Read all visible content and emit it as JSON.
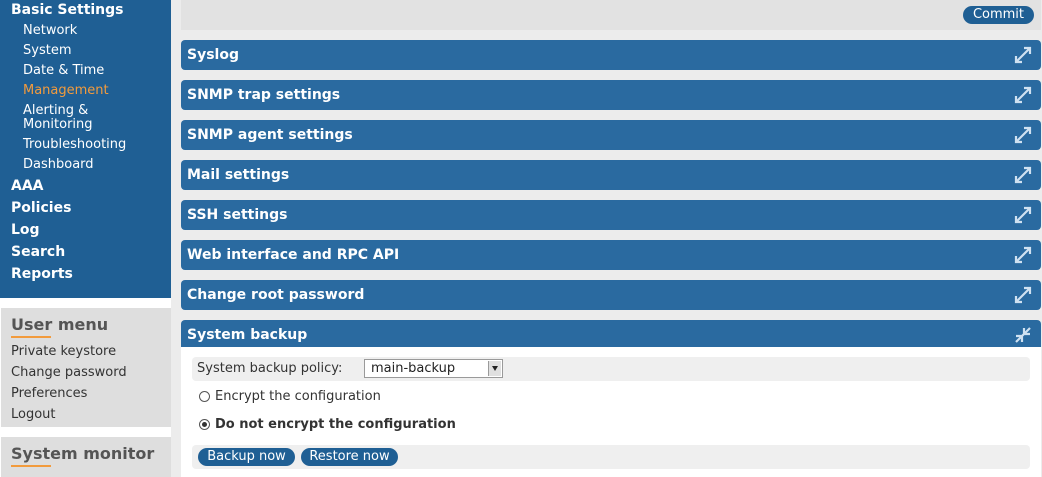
{
  "sidebar": {
    "nav": {
      "basic_settings": "Basic Settings",
      "sub": [
        "Network",
        "System",
        "Date & Time",
        "Management",
        "Alerting &",
        "Monitoring",
        "Troubleshooting",
        "Dashboard"
      ],
      "active_item": "Management",
      "aaa": "AAA",
      "policies": "Policies",
      "log": "Log",
      "search": "Search",
      "reports": "Reports"
    },
    "user_menu": {
      "title": "User menu",
      "links": [
        "Private keystore",
        "Change password",
        "Preferences",
        "Logout"
      ]
    },
    "system_monitor": {
      "title": "System monitor"
    }
  },
  "toolbar": {
    "commit_label": "Commit"
  },
  "panels": [
    {
      "title": "Syslog",
      "state": "collapsed"
    },
    {
      "title": "SNMP trap settings",
      "state": "collapsed"
    },
    {
      "title": "SNMP agent settings",
      "state": "collapsed"
    },
    {
      "title": "Mail settings",
      "state": "collapsed"
    },
    {
      "title": "SSH settings",
      "state": "collapsed"
    },
    {
      "title": "Web interface and RPC API",
      "state": "collapsed"
    },
    {
      "title": "Change root password",
      "state": "collapsed"
    },
    {
      "title": "System backup",
      "state": "expanded"
    }
  ],
  "backup": {
    "policy_label": "System backup policy:",
    "policy_value": "main-backup",
    "encrypt_label": "Encrypt the configuration",
    "no_encrypt_label": "Do not encrypt the configuration",
    "selected_option": "no_encrypt",
    "backup_now_label": "Backup now",
    "restore_now_label": "Restore now"
  },
  "colors": {
    "nav_bg": "#1f5f94",
    "panel_header": "#2a6aa0",
    "accent": "#f29b3d"
  }
}
